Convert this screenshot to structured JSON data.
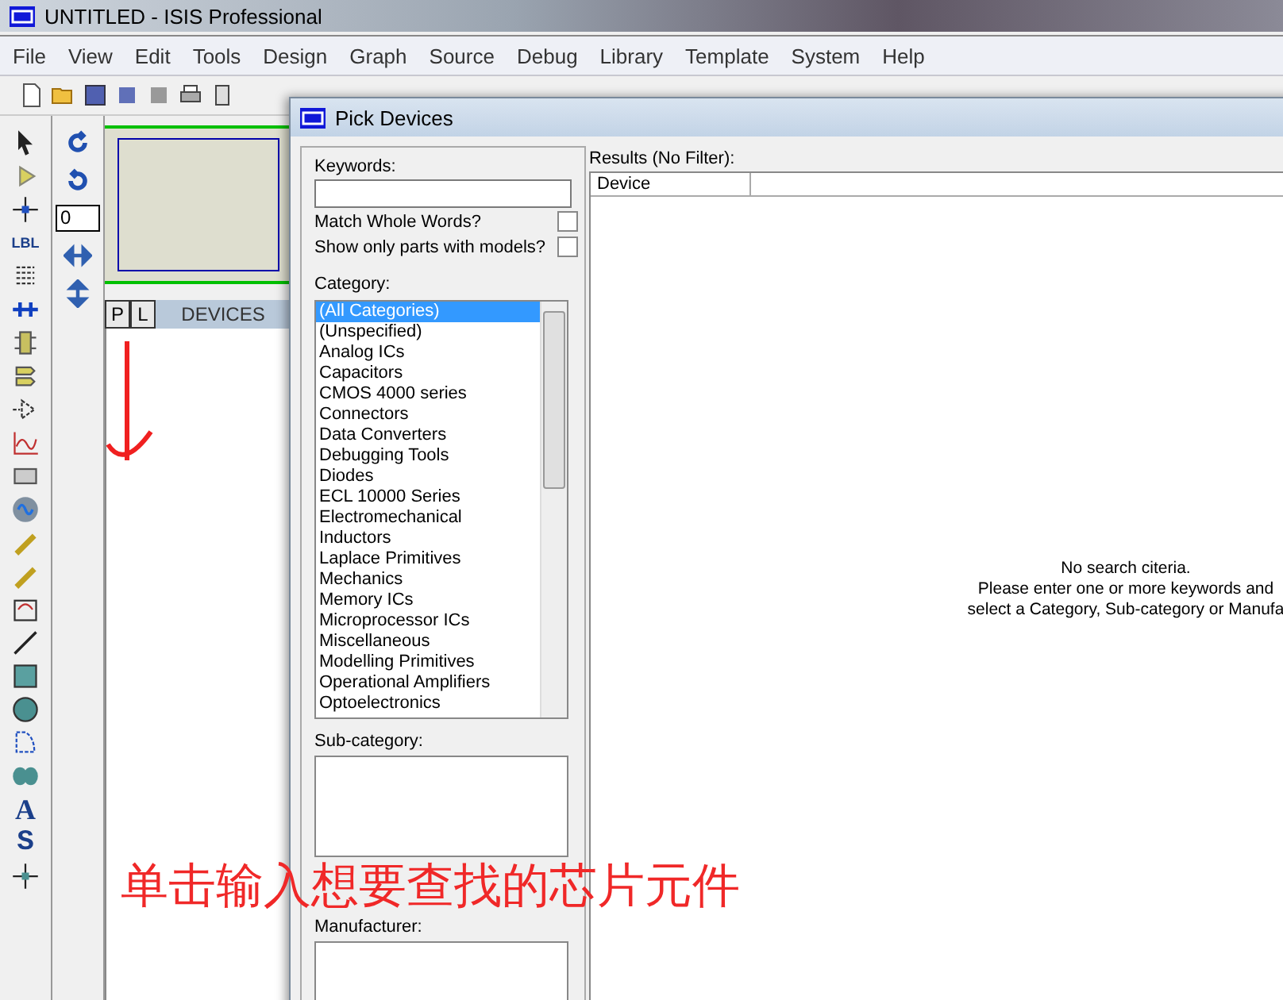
{
  "window": {
    "title": "UNTITLED - ISIS Professional"
  },
  "menu": [
    "File",
    "View",
    "Edit",
    "Tools",
    "Design",
    "Graph",
    "Source",
    "Debug",
    "Library",
    "Template",
    "System",
    "Help"
  ],
  "tool_glyphs": {
    "label": "LBL",
    "text": "A",
    "symbol": "S"
  },
  "rotation_field": {
    "value": "0"
  },
  "device_panel": {
    "tabs": [
      {
        "label": "P",
        "selected": false
      },
      {
        "label": "L",
        "selected": false
      }
    ],
    "title": "DEVICES"
  },
  "dialog": {
    "title": "Pick Devices",
    "keywords_label": "Keywords:",
    "options": [
      {
        "label": "Match Whole Words?",
        "checked": false
      },
      {
        "label": "Show only parts with models?",
        "checked": false
      }
    ],
    "category_label": "Category:",
    "categories": [
      {
        "label": "(All Categories)",
        "selected": true
      },
      {
        "label": "(Unspecified)",
        "selected": false
      },
      {
        "label": "Analog ICs",
        "selected": false
      },
      {
        "label": "Capacitors",
        "selected": false
      },
      {
        "label": "CMOS 4000 series",
        "selected": false
      },
      {
        "label": "Connectors",
        "selected": false
      },
      {
        "label": "Data Converters",
        "selected": false
      },
      {
        "label": "Debugging Tools",
        "selected": false
      },
      {
        "label": "Diodes",
        "selected": false
      },
      {
        "label": "ECL 10000 Series",
        "selected": false
      },
      {
        "label": "Electromechanical",
        "selected": false
      },
      {
        "label": "Inductors",
        "selected": false
      },
      {
        "label": "Laplace Primitives",
        "selected": false
      },
      {
        "label": "Mechanics",
        "selected": false
      },
      {
        "label": "Memory ICs",
        "selected": false
      },
      {
        "label": "Microprocessor ICs",
        "selected": false
      },
      {
        "label": "Miscellaneous",
        "selected": false
      },
      {
        "label": "Modelling Primitives",
        "selected": false
      },
      {
        "label": "Operational Amplifiers",
        "selected": false
      },
      {
        "label": "Optoelectronics",
        "selected": false
      }
    ],
    "subcategory_label": "Sub-category:",
    "manufacturer_label": "Manufacturer:",
    "results_label": "Results (No Filter):",
    "results_columns": [
      "Device"
    ],
    "message": [
      "No search citeria.",
      "Please enter one or more keywords and",
      "select a Category, Sub-category or Manufa"
    ]
  },
  "annotation": {
    "text": "单击输入想要查找的芯片元件"
  }
}
